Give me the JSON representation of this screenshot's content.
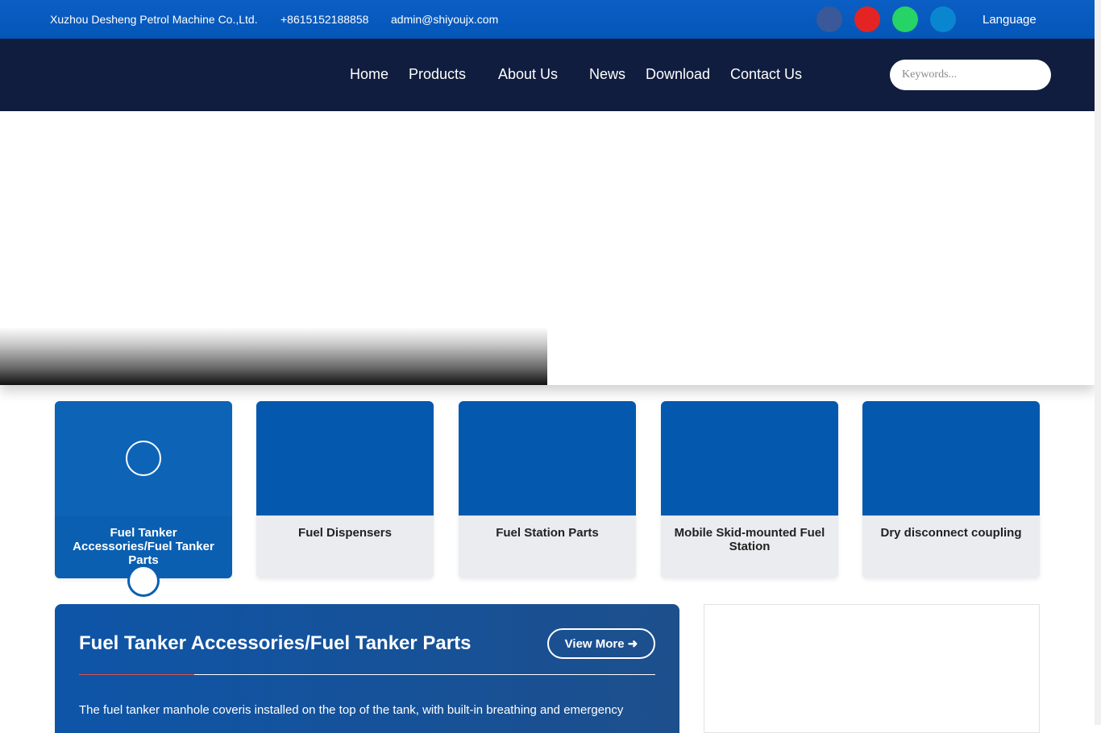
{
  "topbar": {
    "company": "Xuzhou Desheng Petrol Machine Co.,Ltd.",
    "phone": "+8615152188858",
    "email": "admin@shiyoujx.com",
    "language": "Language",
    "social": [
      {
        "icon": "facebook-icon",
        "color": "#3b5998"
      },
      {
        "icon": "youtube-icon",
        "color": "#e32422"
      },
      {
        "icon": "whatsapp-icon",
        "color": "#25d366"
      },
      {
        "icon": "linkedin-icon",
        "color": "#0a86d0"
      }
    ]
  },
  "nav": {
    "items": [
      "Home",
      "Products",
      "About Us",
      "News",
      "Download",
      "Contact Us"
    ],
    "search_placeholder": "Keywords..."
  },
  "categories": [
    {
      "label": "Fuel Tanker Accessories/Fuel Tanker Parts",
      "active": true
    },
    {
      "label": "Fuel Dispensers",
      "active": false
    },
    {
      "label": "Fuel Station Parts",
      "active": false
    },
    {
      "label": "Mobile Skid-mounted Fuel Station",
      "active": false
    },
    {
      "label": "Dry disconnect coupling",
      "active": false
    }
  ],
  "feature": {
    "title": "Fuel Tanker Accessories/Fuel Tanker Parts",
    "view_more": "View More ➜",
    "text": "The fuel tanker manhole coveris installed on the top of the tank, with built-in breathing and emergency"
  },
  "colors": {
    "topbar": "#0456b8",
    "navbar": "#101d3f",
    "accent": "#0459ae"
  }
}
